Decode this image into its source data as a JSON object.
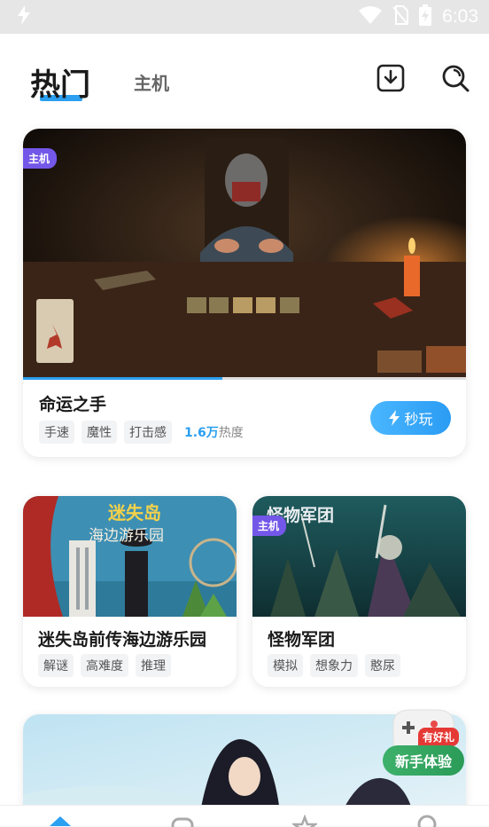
{
  "status": {
    "time": "6:03"
  },
  "header": {
    "tab_hot": "热门",
    "tab_host": "主机"
  },
  "featured": {
    "badge": "主机",
    "title": "命运之手",
    "tags": [
      "手速",
      "魔性",
      "打击感"
    ],
    "heat_value": "1.6万",
    "heat_label": "热度",
    "play_label": "秒玩",
    "progress": 0.45
  },
  "grid": [
    {
      "title": "迷失岛前传海边游乐园",
      "tags": [
        "解谜",
        "高难度",
        "推理"
      ],
      "banner_text_1": "迷失岛",
      "banner_text_2": "海边游乐园"
    },
    {
      "title": "怪物军团",
      "badge": "主机",
      "tags": [
        "模拟",
        "想象力",
        "憨尿"
      ],
      "banner_text_1": "怪物军团"
    }
  ],
  "promo": {
    "badge": "有好礼",
    "label": "新手体验"
  }
}
